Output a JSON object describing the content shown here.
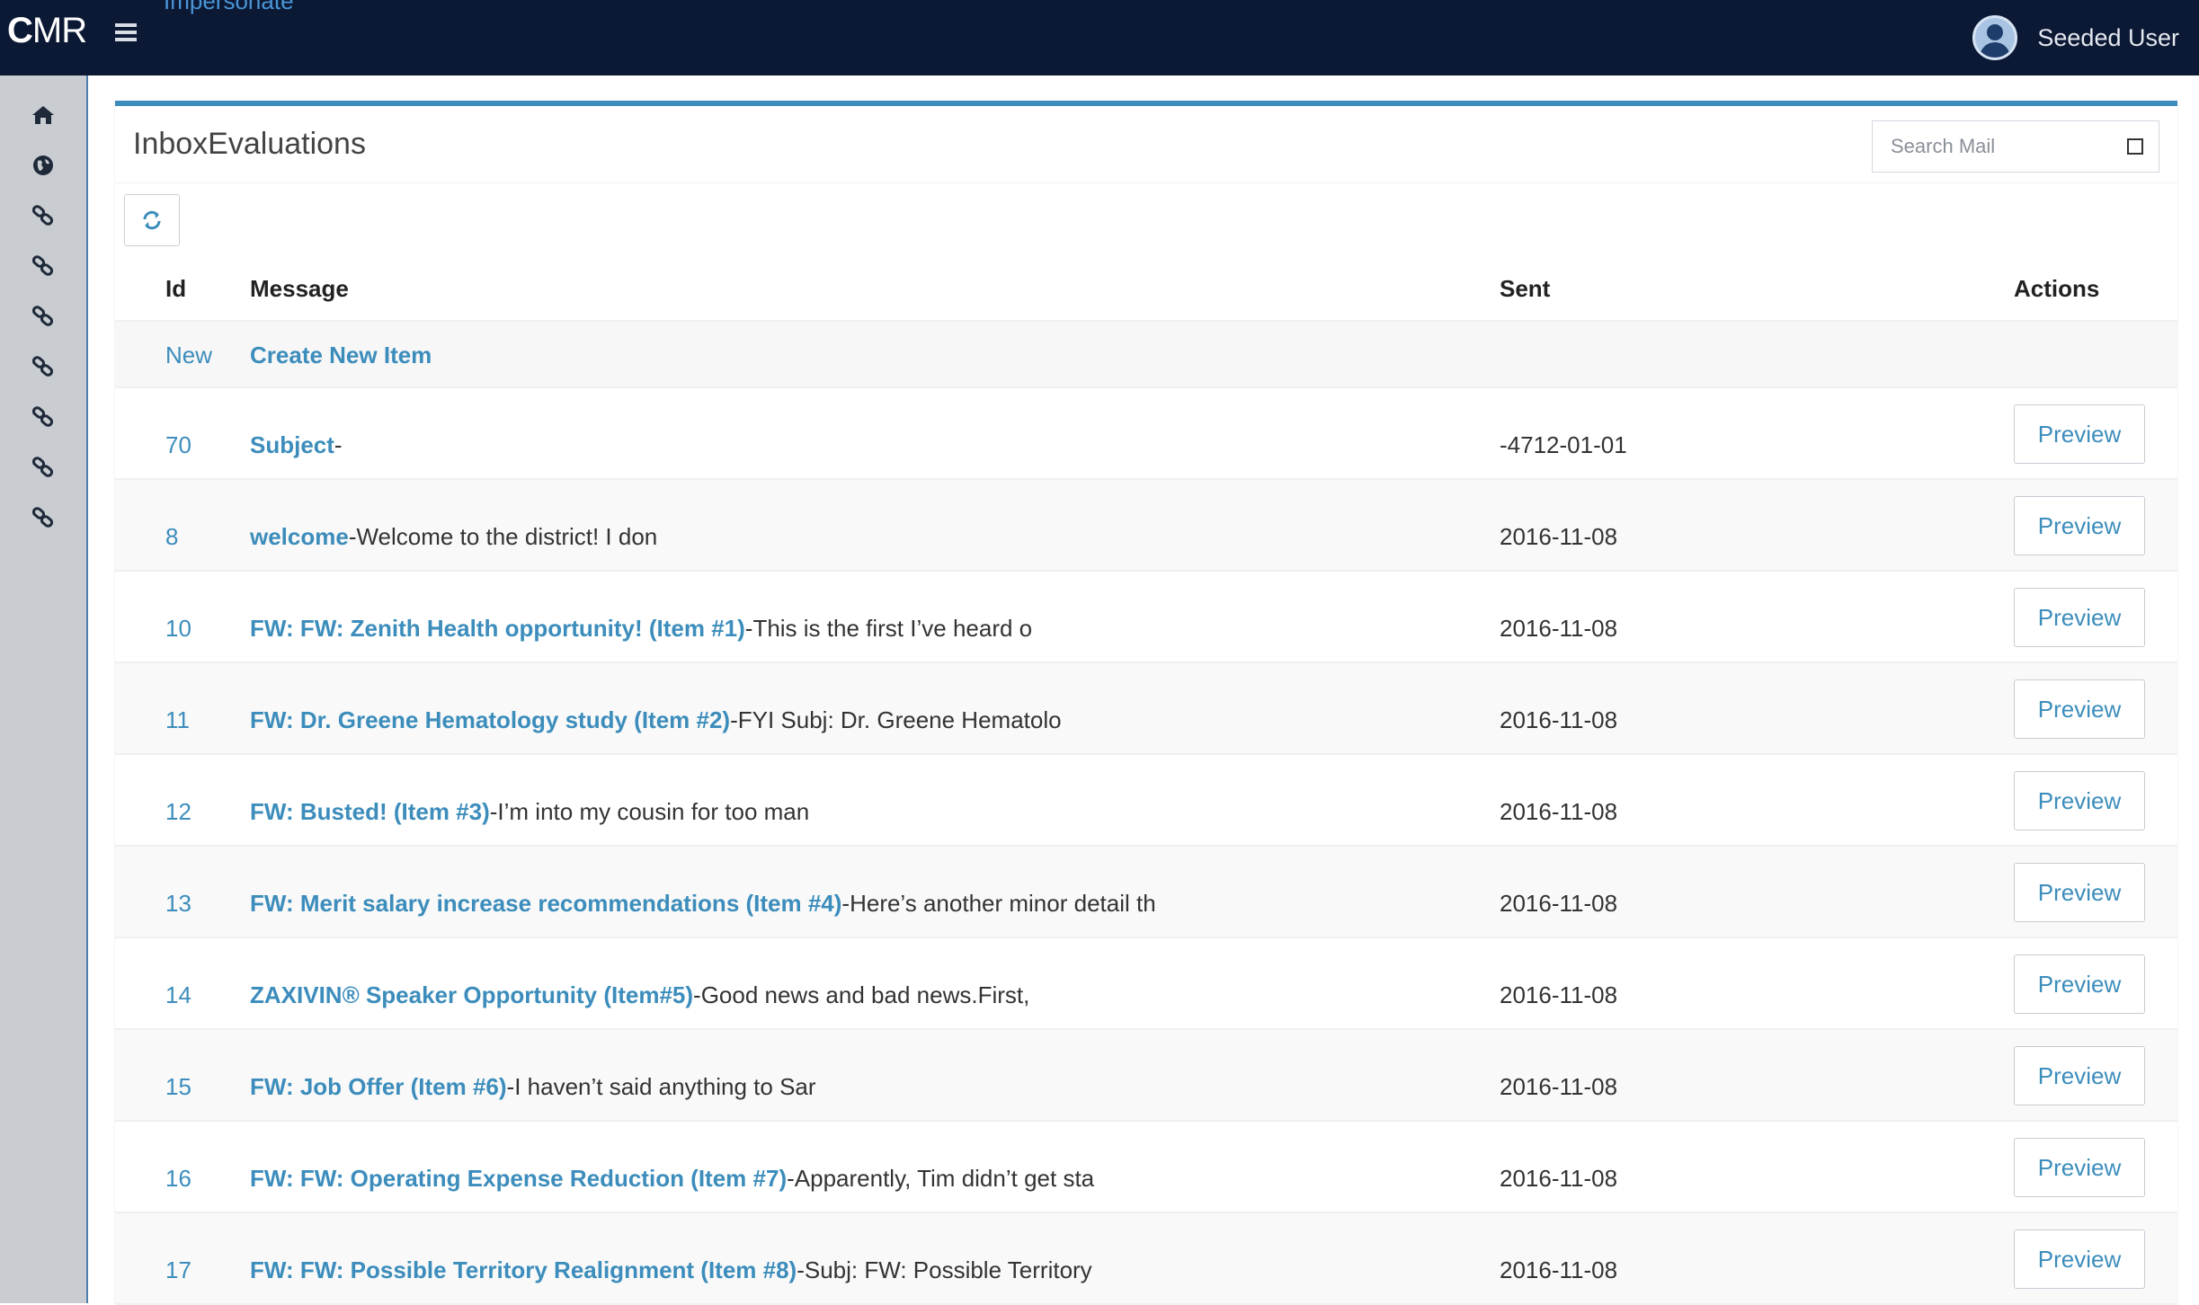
{
  "app": {
    "logo_bold": "C",
    "logo_rest": "MR",
    "impersonate_label": "Impersonate",
    "user_name": "Seeded User"
  },
  "sidebar": {
    "items": [
      {
        "icon": "home-icon"
      },
      {
        "icon": "globe-icon"
      },
      {
        "icon": "link-icon"
      },
      {
        "icon": "link-icon"
      },
      {
        "icon": "link-icon"
      },
      {
        "icon": "link-icon"
      },
      {
        "icon": "link-icon"
      },
      {
        "icon": "link-icon"
      },
      {
        "icon": "link-icon"
      }
    ]
  },
  "box": {
    "title": "InboxEvaluations",
    "search_placeholder": "Search Mail",
    "accent_color": "#3c8dbc"
  },
  "table": {
    "headers": {
      "id": "Id",
      "message": "Message",
      "sent": "Sent",
      "actions": "Actions"
    },
    "new_row": {
      "id": "New",
      "label": "Create New Item"
    },
    "preview_label": "Preview",
    "rows": [
      {
        "id": "70",
        "subject": "Subject",
        "snippet": "-",
        "sent": "-4712-01-01"
      },
      {
        "id": "8",
        "subject": "welcome",
        "snippet": "-Welcome to the district! I don",
        "sent": "2016-11-08"
      },
      {
        "id": "10",
        "subject": "FW: FW: Zenith Health opportunity! (Item #1)",
        "snippet": "-This is the first I’ve heard o",
        "sent": "2016-11-08"
      },
      {
        "id": "11",
        "subject": "FW: Dr. Greene Hematology study (Item #2)",
        "snippet": "-FYI Subj: Dr. Greene Hematolo",
        "sent": "2016-11-08"
      },
      {
        "id": "12",
        "subject": "FW: Busted! (Item #3)",
        "snippet": "-I’m into my cousin for too man",
        "sent": "2016-11-08"
      },
      {
        "id": "13",
        "subject": "FW: Merit salary increase recommendations (Item #4)",
        "snippet": "-Here’s another minor detail th",
        "sent": "2016-11-08"
      },
      {
        "id": "14",
        "subject": "ZAXIVIN® Speaker Opportunity (Item#5)",
        "snippet": "-Good news and bad news.First,",
        "sent": "2016-11-08"
      },
      {
        "id": "15",
        "subject": "FW: Job Offer (Item #6)",
        "snippet": "-I haven’t said anything to Sar",
        "sent": "2016-11-08"
      },
      {
        "id": "16",
        "subject": "FW: FW: Operating Expense Reduction (Item #7)",
        "snippet": "-Apparently, Tim didn’t get sta",
        "sent": "2016-11-08"
      },
      {
        "id": "17",
        "subject": "FW: FW: Possible Territory Realignment (Item #8)",
        "snippet": "-Subj: FW: Possible Territory",
        "sent": "2016-11-08"
      }
    ]
  }
}
